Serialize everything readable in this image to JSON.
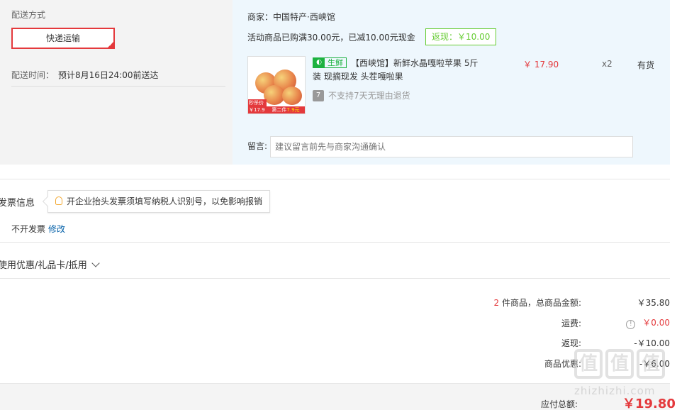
{
  "shipping": {
    "label": "配送方式",
    "method": "快递运输",
    "time_label": "配送时间：",
    "time_value": "预计8月16日24:00前送达"
  },
  "merchant": {
    "name": "商家：中国特产·西峡馆",
    "promo": "活动商品已购满30.00元，已减10.00元现金",
    "cashback": "返现：￥10.00"
  },
  "product": {
    "fresh_badge": "生鲜",
    "title": "【西峡馆】新鲜水晶嘎啦苹果 5斤装 现摘现发 头茬嘎啦果",
    "no_return": "不支持7天无理由退货",
    "no_return_icon_text": "7",
    "price": "￥ 17.90",
    "qty": "x2",
    "stock": "有货",
    "image_tag_1": "秒杀价",
    "image_tag_1_price": "￥17.9",
    "image_tag_2_text": "第二件",
    "image_tag_2_price": "7.9元"
  },
  "message": {
    "label": "留言:",
    "placeholder": "建议留言前先与商家沟通确认"
  },
  "invoice": {
    "label": "发票信息",
    "tip": "开企业抬头发票须填写纳税人识别号，以免影响报销",
    "value": "不开发票",
    "edit": "修改"
  },
  "coupon": {
    "label": "使用优惠/礼品卡/抵用"
  },
  "summary": {
    "count": "2",
    "count_suffix": "件商品，总商品金额:",
    "total": "￥35.80",
    "shipping_label": "运费:",
    "shipping_value": "￥0.00",
    "cashback_label": "返现:",
    "cashback_value": "-￥10.00",
    "discount_label": "商品优惠:",
    "discount_value": "-￥6.00",
    "pay_label": "应付总额:",
    "pay_value": "￥19.80"
  },
  "watermark": {
    "logo_chars": [
      "值",
      "值",
      "值"
    ],
    "url": "zhizhizhi.com"
  },
  "colors": {
    "accent_red": "#e4393c",
    "fresh_green": "#1db240",
    "cashback_green": "#66cc33",
    "link_blue": "#005ea7",
    "panel_blue": "#eef7fd"
  }
}
